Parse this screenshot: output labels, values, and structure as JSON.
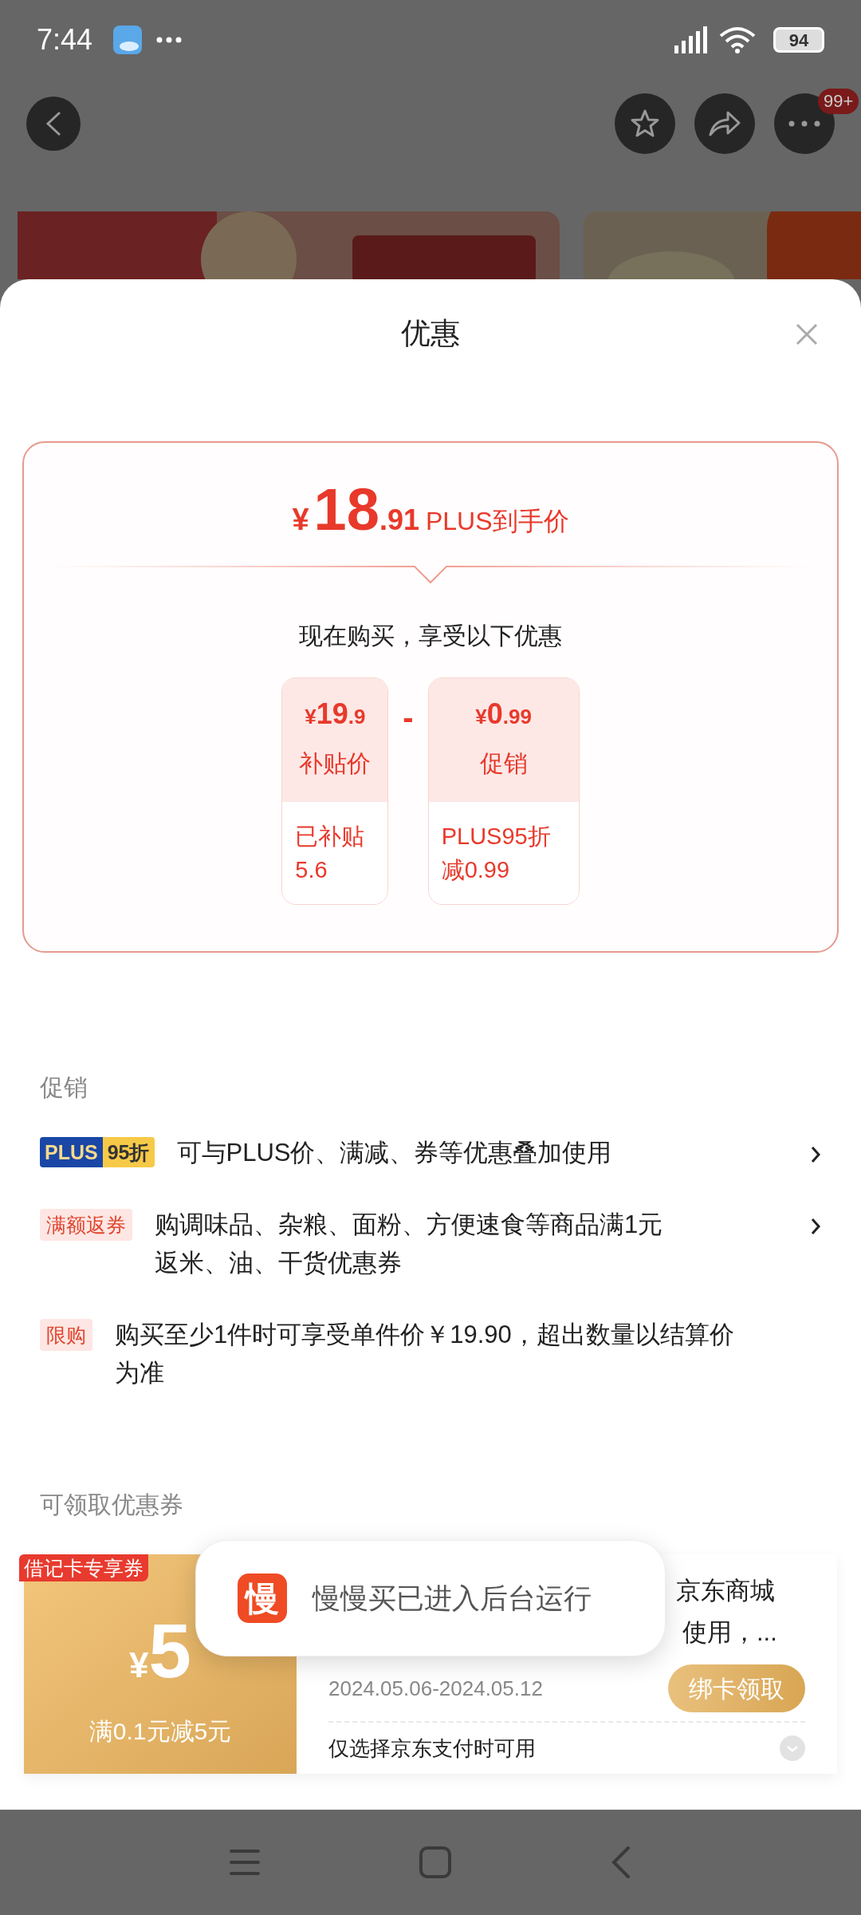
{
  "status_bar": {
    "time": "7:44",
    "battery": "94"
  },
  "top_bar": {
    "badge": "99+"
  },
  "sheet": {
    "title": "优惠"
  },
  "price_card": {
    "currency": "¥",
    "whole": "18",
    "fraction": ".91",
    "label": "PLUS到手价",
    "subtitle": "现在购买，享受以下优惠",
    "operator": "-",
    "items": [
      {
        "currency": "¥",
        "whole": "19",
        "fraction": ".9",
        "label": "补贴价",
        "note": [
          "已补贴",
          "5.6"
        ]
      },
      {
        "currency": "¥",
        "whole": "0",
        "fraction": ".99",
        "label": "促销",
        "note": [
          "PLUS95折",
          "减0.99"
        ]
      }
    ]
  },
  "promotions": {
    "heading": "促销",
    "items": [
      {
        "kind": "plus",
        "tag": "PLUS",
        "tag_extra": "95折",
        "text": "可与PLUS价、满减、券等优惠叠加使用",
        "arrow": true
      },
      {
        "kind": "tag",
        "tag": "满额返券",
        "text": "购调味品、杂粮、面粉、方便速食等商品满1元返米、油、干货优惠券",
        "arrow": true
      },
      {
        "kind": "tag",
        "tag": "限购",
        "text": "购买至少1件时可享受单件价￥19.90，超出数量以结算价为准",
        "arrow": false
      }
    ]
  },
  "coupons": {
    "heading": "可领取优惠券",
    "items": [
      {
        "ribbon": "借记卡专享券",
        "currency": "¥",
        "amount": "5",
        "condition": "满0.1元减5元",
        "desc_lines": [
          "京东商城",
          "使用，..."
        ],
        "dates": "2024.05.06-2024.05.12",
        "button": "绑卡领取",
        "footer": "仅选择京东支付时可用"
      }
    ]
  },
  "toast": {
    "icon": "慢",
    "text": "慢慢买已进入后台运行"
  }
}
